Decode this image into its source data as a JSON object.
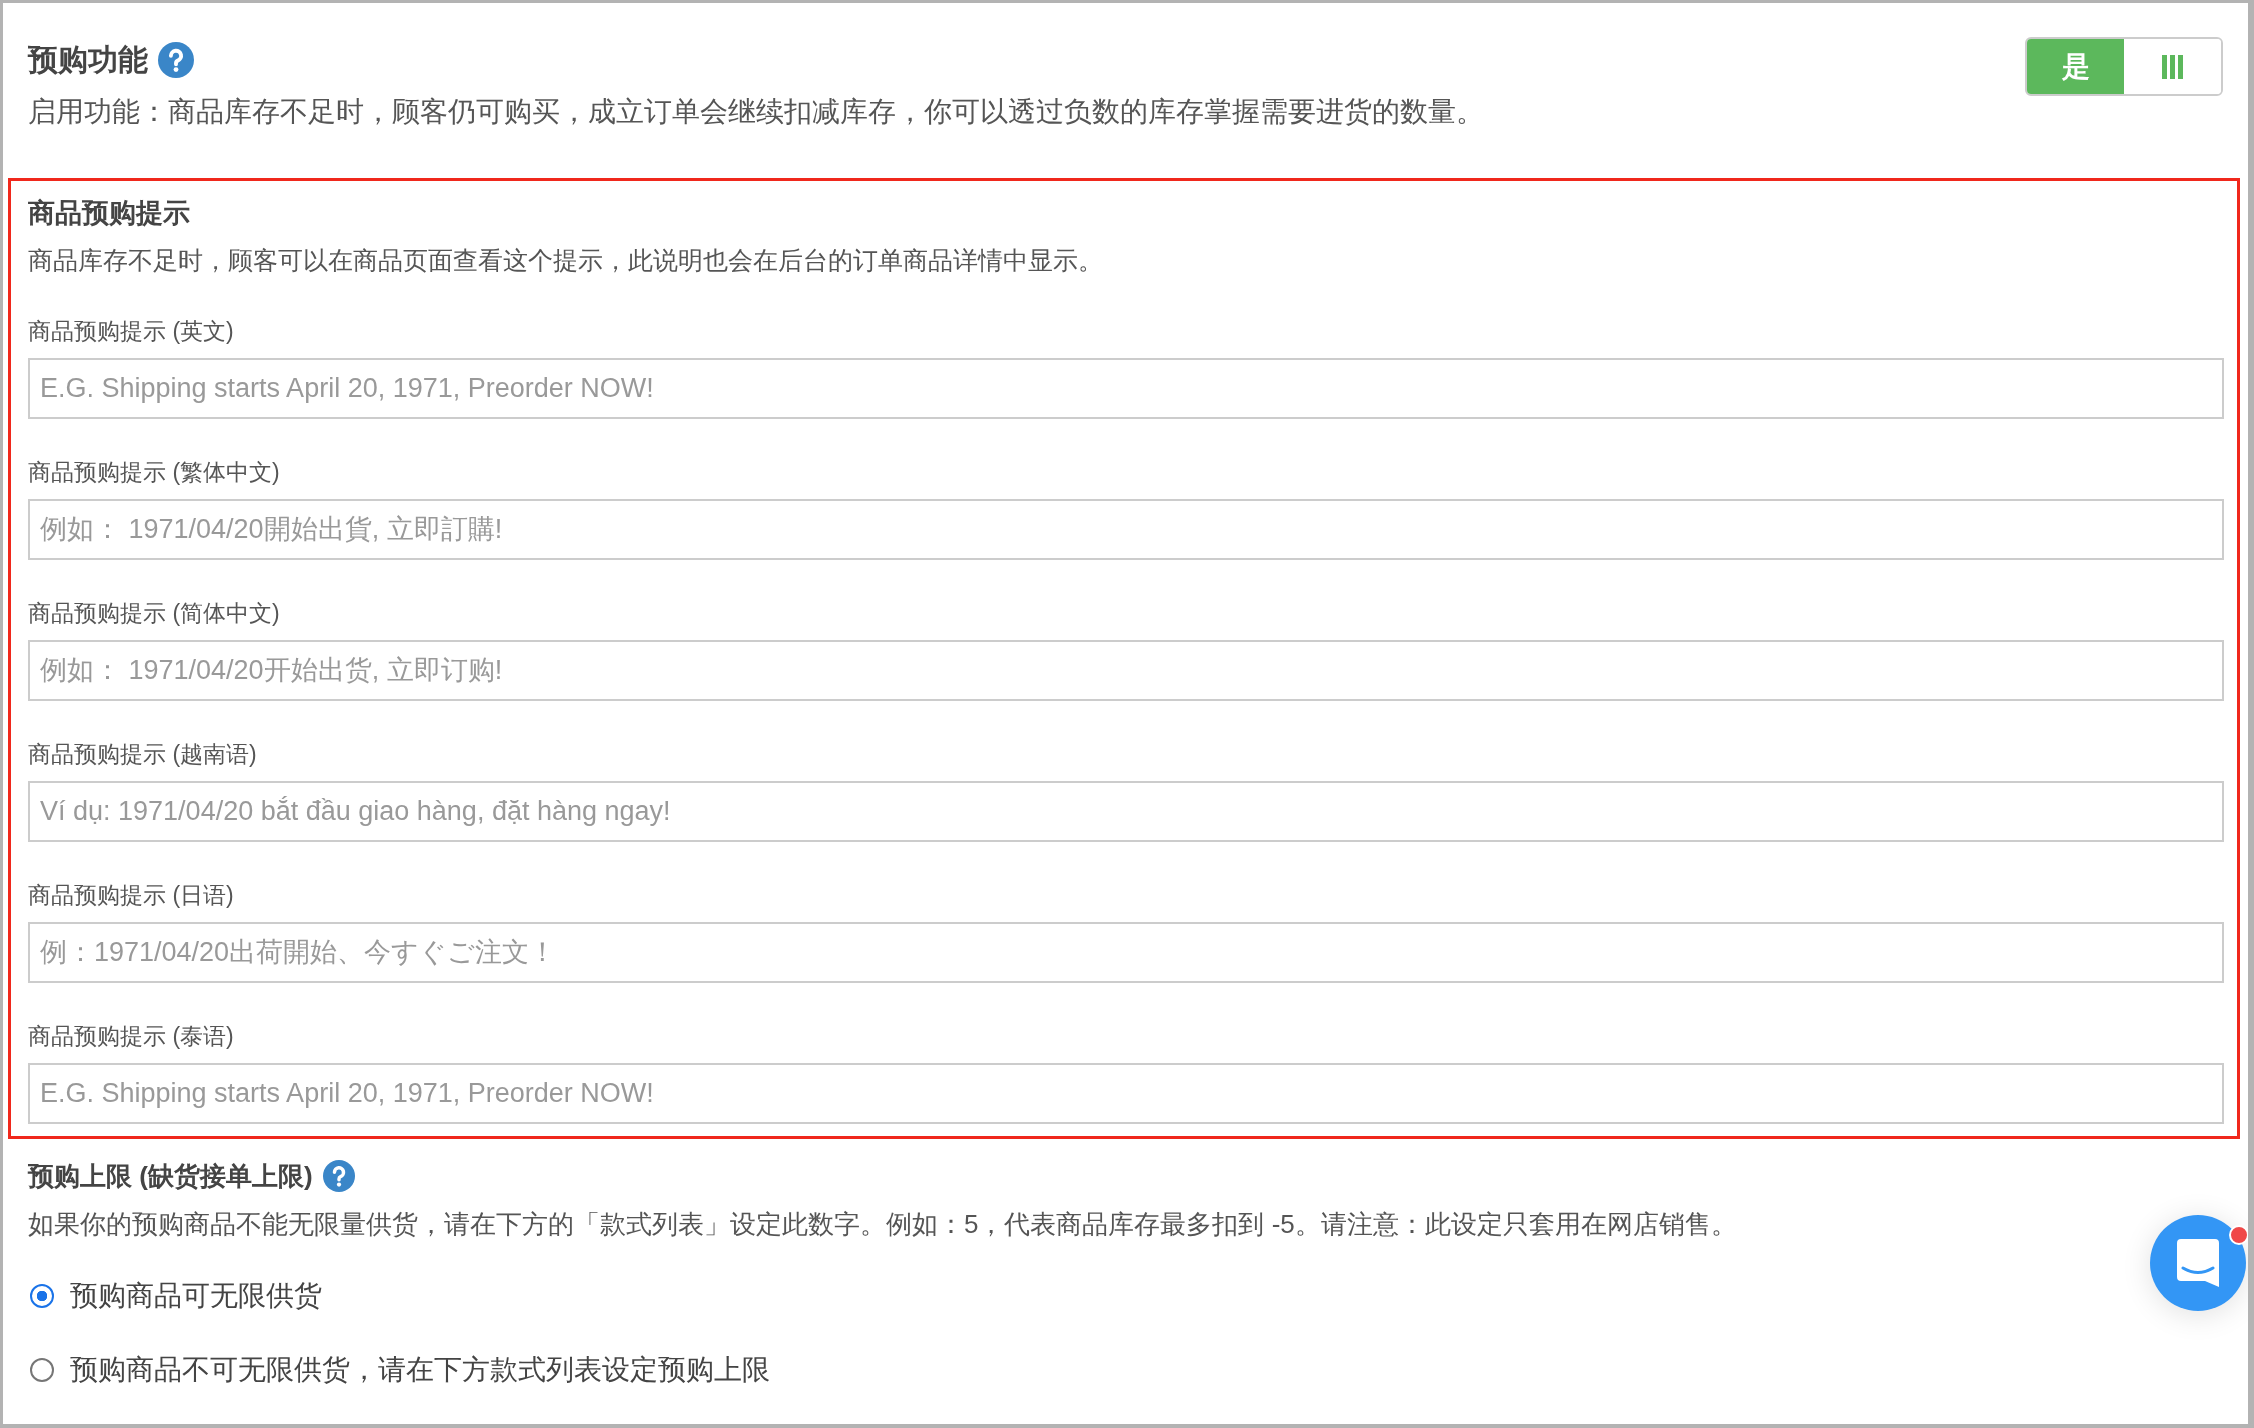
{
  "preorder": {
    "title": "预购功能",
    "description": "启用功能：商品库存不足时，顾客仍可购买，成立订单会继续扣减库存，你可以透过负数的库存掌握需要进货的数量。",
    "toggle": {
      "label": "是",
      "on": true
    }
  },
  "preorder_note": {
    "highlighted": true,
    "title": "商品预购提示",
    "description": "商品库存不足时，顾客可以在商品页面查看这个提示，此说明也会在后台的订单商品详情中显示。",
    "fields": [
      {
        "label": "商品预购提示 (英文)",
        "placeholder": "E.G. Shipping starts April 20, 1971, Preorder NOW!"
      },
      {
        "label": "商品预购提示 (繁体中文)",
        "placeholder": "例如： 1971/04/20開始出貨, 立即訂購!"
      },
      {
        "label": "商品预购提示 (简体中文)",
        "placeholder": "例如： 1971/04/20开始出货, 立即订购!"
      },
      {
        "label": "商品预购提示 (越南语)",
        "placeholder": "Ví dụ: 1971/04/20 bắt đầu giao hàng, đặt hàng ngay!"
      },
      {
        "label": "商品预购提示 (日语)",
        "placeholder": "例：1971/04/20出荷開始、今すぐご注文！"
      },
      {
        "label": "商品预购提示 (泰语)",
        "placeholder": "E.G. Shipping starts April 20, 1971, Preorder NOW!"
      }
    ]
  },
  "preorder_limit": {
    "title": "预购上限 (缺货接单上限)",
    "description": "如果你的预购商品不能无限量供货，请在下方的「款式列表」设定此数字。例如：5，代表商品库存最多扣到 -5。请注意：此设定只套用在网店销售。",
    "options": [
      {
        "label": "预购商品可无限供货",
        "selected": true
      },
      {
        "label": "预购商品不可无限供货，请在下方款式列表设定预购上限",
        "selected": false
      }
    ]
  },
  "chat_widget": {
    "unread": true
  }
}
